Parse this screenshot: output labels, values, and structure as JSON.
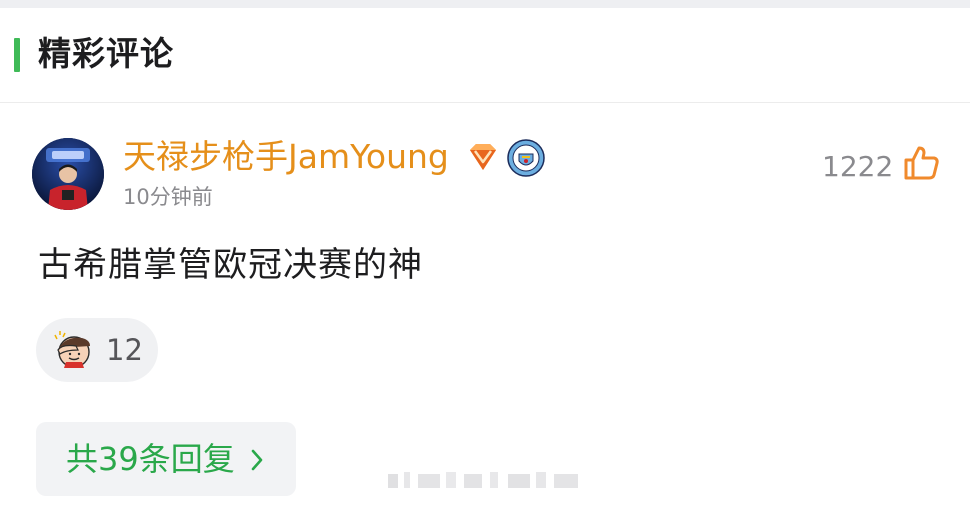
{
  "section": {
    "title": "精彩评论"
  },
  "comment": {
    "username": "天禄步枪手JamYoung",
    "time": "10分钟前",
    "like_count": "1222",
    "text": "古希腊掌管欧冠决赛的神",
    "reaction_count": "12",
    "reply_label": "共39条回复"
  },
  "colors": {
    "accent_green": "#3fba57",
    "username_orange": "#e58f1a",
    "reply_green": "#2aa84a"
  },
  "icons": {
    "vip": "diamond-badge-icon",
    "club": "man-city-badge-icon",
    "like": "thumbs-up-icon",
    "reaction": "facepalm-emoji-icon",
    "chevron": "chevron-right-icon"
  }
}
